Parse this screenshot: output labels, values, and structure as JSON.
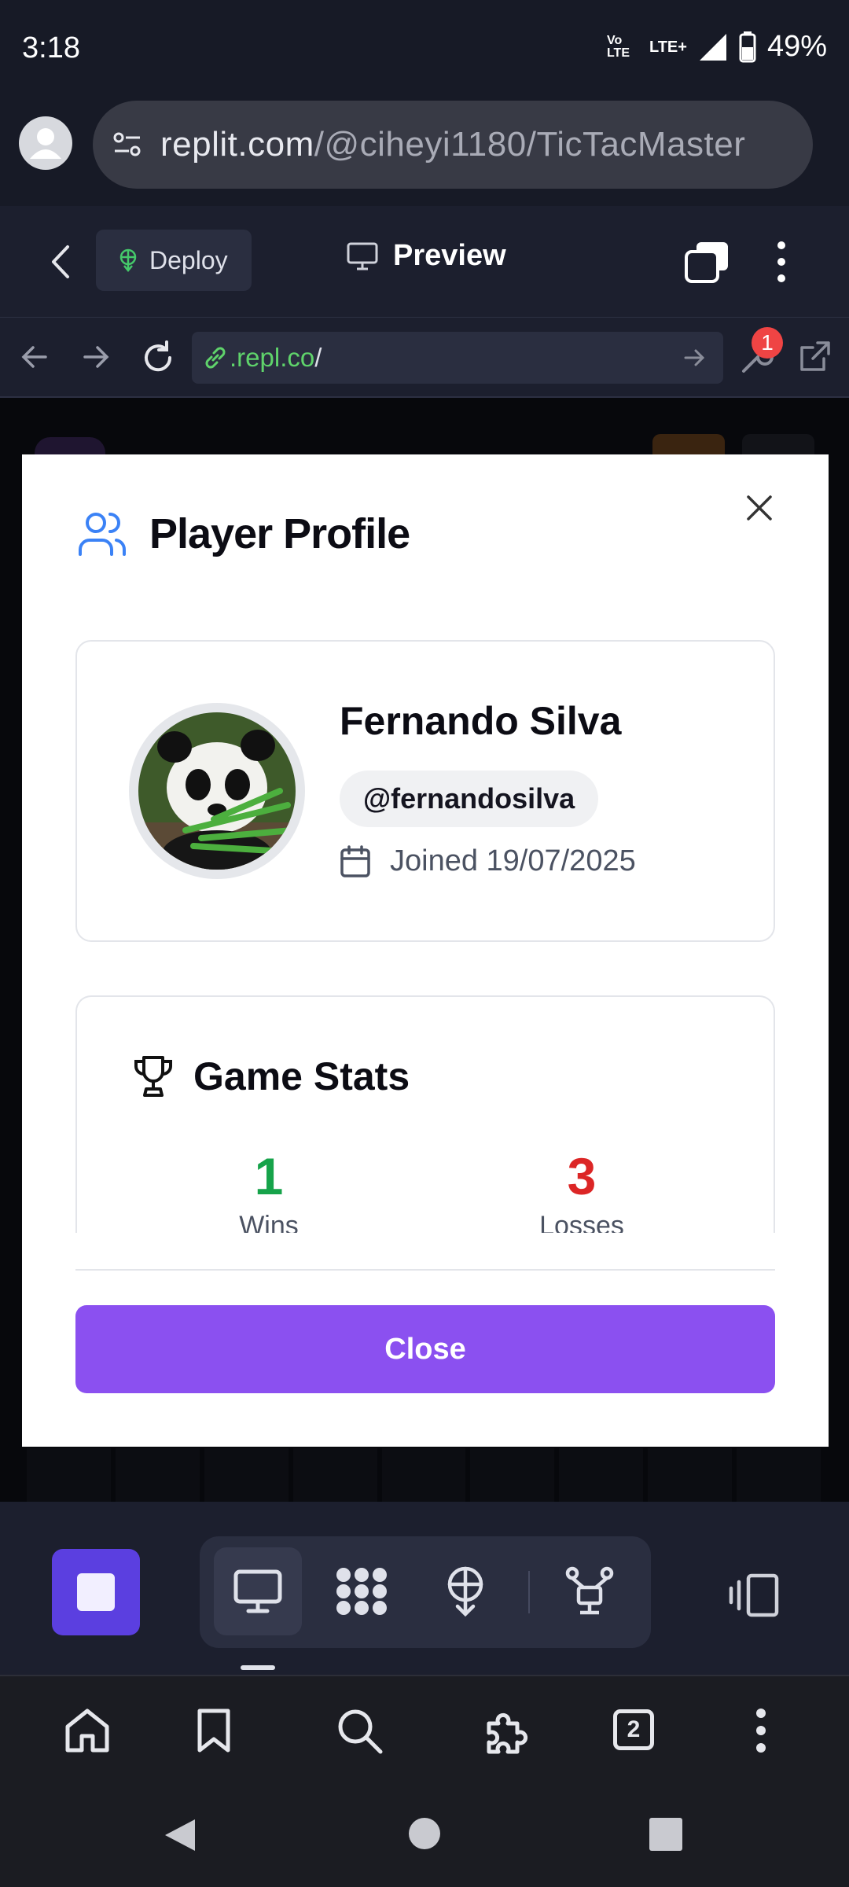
{
  "status_bar": {
    "time": "3:18",
    "volte": "Vo LTE",
    "network": "LTE+",
    "battery": "49%"
  },
  "browser": {
    "url_host": "replit.com",
    "url_path": "/@ciheyi1180/TicTacMaster"
  },
  "replit_header": {
    "deploy_label": "Deploy",
    "preview_label": "Preview"
  },
  "webview": {
    "address_host": ".repl.co",
    "address_slash": "/",
    "notification_count": "1"
  },
  "modal": {
    "title": "Player Profile",
    "player": {
      "name": "Fernando Silva",
      "handle": "@fernandosilva",
      "joined": "Joined 19/07/2025"
    },
    "stats": {
      "title": "Game Stats",
      "wins_value": "1",
      "wins_label": "Wins",
      "losses_value": "3",
      "losses_label": "Losses"
    },
    "close_label": "Close"
  },
  "browser_nav": {
    "tab_count": "2"
  },
  "colors": {
    "accent_purple": "#8b50f0",
    "win_green": "#16a34a",
    "loss_red": "#dc2626",
    "stop_purple": "#5b3fe0"
  }
}
